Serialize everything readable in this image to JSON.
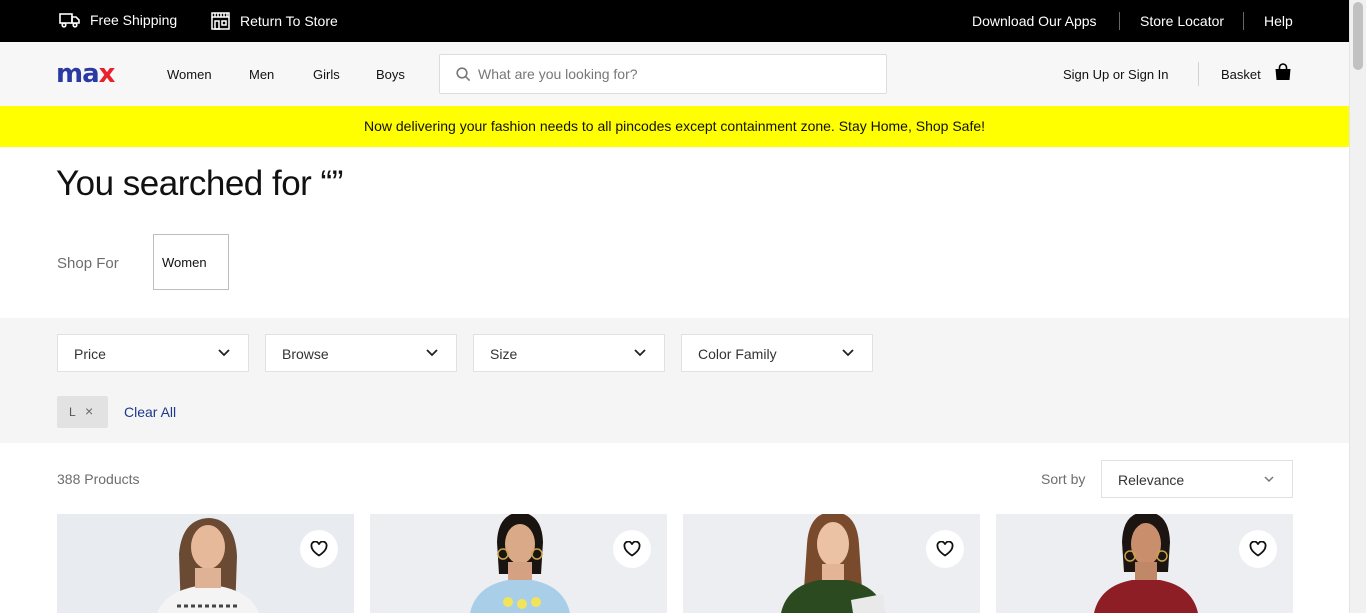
{
  "topbar": {
    "free_shipping": "Free Shipping",
    "return_to_store": "Return To Store",
    "download_apps": "Download Our Apps",
    "store_locator": "Store Locator",
    "help": "Help"
  },
  "header": {
    "logo": {
      "part1": "ma",
      "part2": "x"
    },
    "nav": [
      "Women",
      "Men",
      "Girls",
      "Boys"
    ],
    "search_placeholder": "What are you looking for?",
    "signin": "Sign Up or Sign In",
    "basket": "Basket"
  },
  "banner": "Now delivering your fashion needs to all pincodes except containment zone. Stay Home, Shop Safe!",
  "search_heading": "You searched for “”",
  "shop_for": {
    "label": "Shop For",
    "option": "Women"
  },
  "filters": [
    "Price",
    "Browse",
    "Size",
    "Color Family"
  ],
  "applied_filter": {
    "value": "L",
    "remove": "×"
  },
  "clear_all": "Clear All",
  "product_count": "388 Products",
  "sort": {
    "label": "Sort by",
    "value": "Relevance"
  },
  "colors": {
    "brand_blue": "#2b3aa3",
    "brand_red": "#e8212d",
    "banner": "#ffff00",
    "link": "#1d3a8a"
  },
  "icons": [
    "truck-icon",
    "store-icon",
    "search-icon",
    "basket-icon",
    "chevron-down-icon",
    "heart-icon"
  ]
}
